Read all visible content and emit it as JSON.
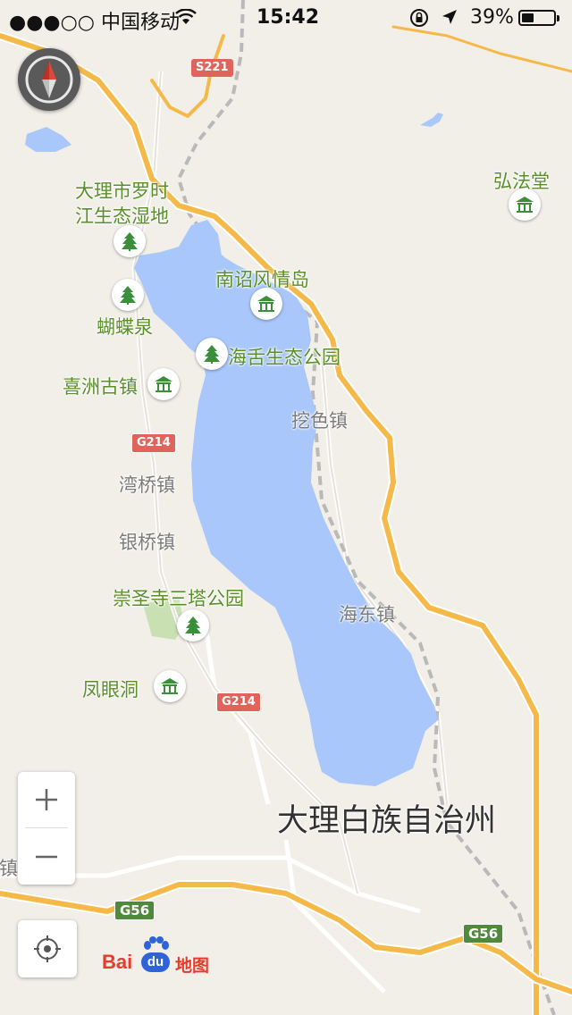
{
  "status_bar": {
    "carrier": "●●●○○ 中国移动",
    "time": "15:42",
    "battery_percent": "39%",
    "battery_level": 0.39,
    "icons": [
      "wifi-icon",
      "orientation-lock-icon",
      "location-arrow-icon",
      "battery-icon"
    ]
  },
  "map": {
    "lake_color": "#a9c7fb",
    "background_color": "#f2efe9",
    "highway_color": "#f5b94a",
    "place_labels": [
      {
        "id": "luoshijiang",
        "text": "大理市罗时\n江生态湿地",
        "style": "green"
      },
      {
        "id": "nanzhao",
        "text": "南诏风情岛",
        "style": "green"
      },
      {
        "id": "hongfatang",
        "text": "弘法堂",
        "style": "green"
      },
      {
        "id": "hudiequan",
        "text": "蝴蝶泉",
        "style": "green"
      },
      {
        "id": "haishe",
        "text": "海舌生态公园",
        "style": "green"
      },
      {
        "id": "xizhou",
        "text": "喜洲古镇",
        "style": "green"
      },
      {
        "id": "wase",
        "text": "挖色镇",
        "style": "gray"
      },
      {
        "id": "wanqiao",
        "text": "湾桥镇",
        "style": "gray"
      },
      {
        "id": "yinqiao",
        "text": "银桥镇",
        "style": "gray"
      },
      {
        "id": "chongsheng",
        "text": "崇圣寺三塔公园",
        "style": "green"
      },
      {
        "id": "haidong",
        "text": "海东镇",
        "style": "gray"
      },
      {
        "id": "fengyandong",
        "text": "凤眼洞",
        "style": "green"
      },
      {
        "id": "dali_prefecture",
        "text": "大理白族自治州",
        "style": "big"
      },
      {
        "id": "edge_town",
        "text": "坡镇",
        "style": "gray"
      }
    ],
    "road_shields": [
      {
        "id": "s221",
        "text": "S221",
        "kind": "provincial"
      },
      {
        "id": "g214_a",
        "text": "G214",
        "kind": "provincial"
      },
      {
        "id": "g214_b",
        "text": "G214",
        "kind": "provincial"
      },
      {
        "id": "g56_a",
        "text": "G56",
        "kind": "national"
      },
      {
        "id": "g56_b",
        "text": "G56",
        "kind": "national"
      }
    ],
    "pois": [
      {
        "id": "luoshijiang",
        "icon": "park-tree-icon"
      },
      {
        "id": "hudiequan",
        "icon": "park-tree-icon"
      },
      {
        "id": "haishe",
        "icon": "park-tree-icon"
      },
      {
        "id": "chongsheng",
        "icon": "park-tree-icon"
      },
      {
        "id": "nanzhao",
        "icon": "temple-icon"
      },
      {
        "id": "hongfatang",
        "icon": "temple-icon"
      },
      {
        "id": "xizhou",
        "icon": "temple-icon"
      },
      {
        "id": "fengyandong",
        "icon": "temple-icon"
      }
    ]
  },
  "controls": {
    "compass": "compass-icon",
    "zoom_in": "+",
    "zoom_out": "−",
    "locate": "locate-icon"
  },
  "logo": {
    "bai": "Bai",
    "du": "du",
    "ditu": "地图"
  }
}
